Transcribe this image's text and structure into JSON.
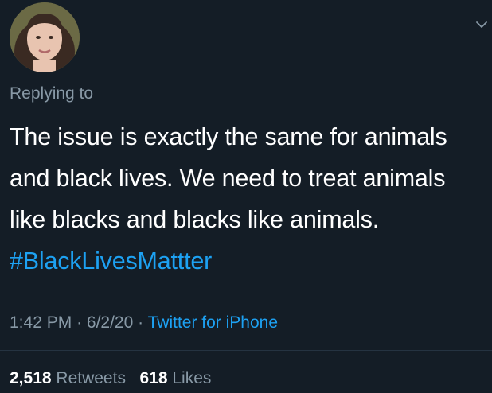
{
  "tweet": {
    "replying_label": "Replying to",
    "text_main": "The issue is exactly the same for animals and black lives. We need to treat animals like blacks and blacks like animals.",
    "hashtag": "#BlackLivesMattter",
    "time": "1:42 PM",
    "date": "6/2/20",
    "separator": "·",
    "source": "Twitter for iPhone",
    "retweets_count": "2,518",
    "retweets_label": "Retweets",
    "likes_count": "618",
    "likes_label": "Likes"
  },
  "icons": {
    "avatar": "avatar",
    "more": "chevron-down-icon"
  },
  "colors": {
    "background": "#141d26",
    "text": "#ffffff",
    "muted": "#8899a6",
    "link": "#1da1f2"
  }
}
